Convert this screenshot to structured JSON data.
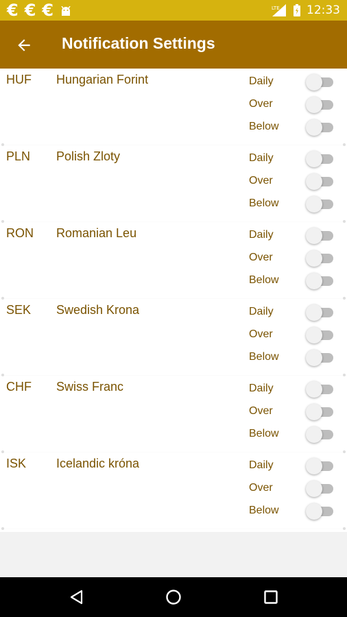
{
  "status_bar": {
    "notification_icons": [
      "euro-icon",
      "euro-icon",
      "euro-icon",
      "android-icon"
    ],
    "time": "12:33",
    "signal_label": "LTE"
  },
  "toolbar": {
    "title": "Notification Settings"
  },
  "currencies": [
    {
      "code": "HUF",
      "name": "Hungarian Forint"
    },
    {
      "code": "PLN",
      "name": "Polish Zloty"
    },
    {
      "code": "RON",
      "name": "Romanian Leu"
    },
    {
      "code": "SEK",
      "name": "Swedish Krona"
    },
    {
      "code": "CHF",
      "name": "Swiss Franc"
    },
    {
      "code": "ISK",
      "name": "Icelandic króna"
    }
  ],
  "options": [
    "Daily",
    "Over",
    "Below"
  ],
  "switch_states": "all-off",
  "colors": {
    "status_bar": "#d6b30f",
    "toolbar": "#a26c00",
    "text": "#7a5300"
  }
}
